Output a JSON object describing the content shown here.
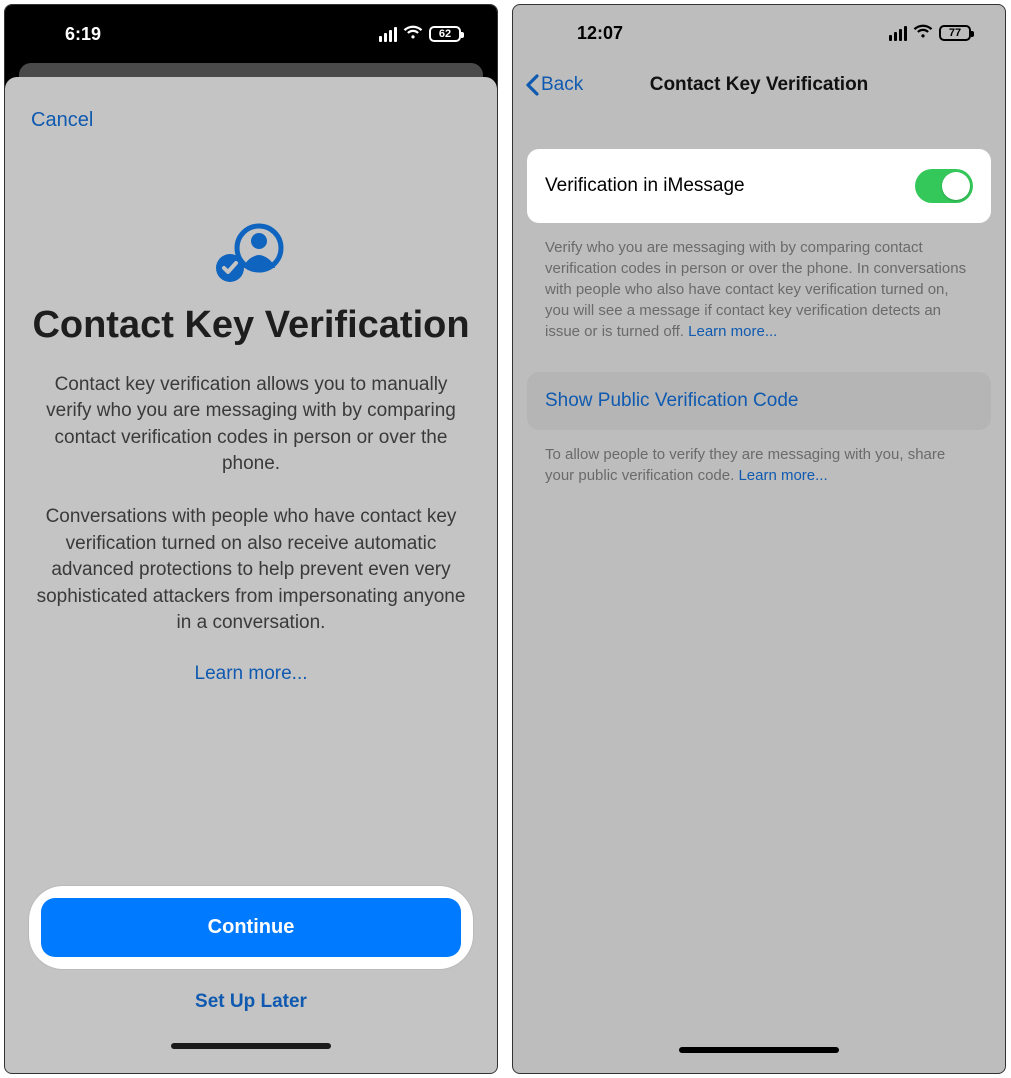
{
  "left": {
    "status": {
      "time": "6:19",
      "battery": "62"
    },
    "cancel": "Cancel",
    "title": "Contact Key Verification",
    "para1": "Contact key verification allows you to manually verify who you are messaging with by comparing contact verification codes in person or over the phone.",
    "para2": "Conversations with people who have contact key verification turned on also receive automatic advanced protections to help prevent even very sophisticated attackers from impersonating anyone in a conversation.",
    "learn_more": "Learn more...",
    "continue": "Continue",
    "setup_later": "Set Up Later"
  },
  "right": {
    "status": {
      "time": "12:07",
      "battery": "77"
    },
    "back": "Back",
    "nav_title": "Contact Key Verification",
    "toggle_label": "Verification in iMessage",
    "toggle_on": true,
    "footer1_text": "Verify who you are messaging with by comparing contact verification codes in person or over the phone. In conversations with people who also have contact key verification turned on, you will see a message if contact key verification detects an issue or is turned off. ",
    "footer1_learn": "Learn more...",
    "show_code": "Show Public Verification Code",
    "footer2_text": "To allow people to verify they are messaging with you, share your public verification code. ",
    "footer2_learn": "Learn more..."
  }
}
